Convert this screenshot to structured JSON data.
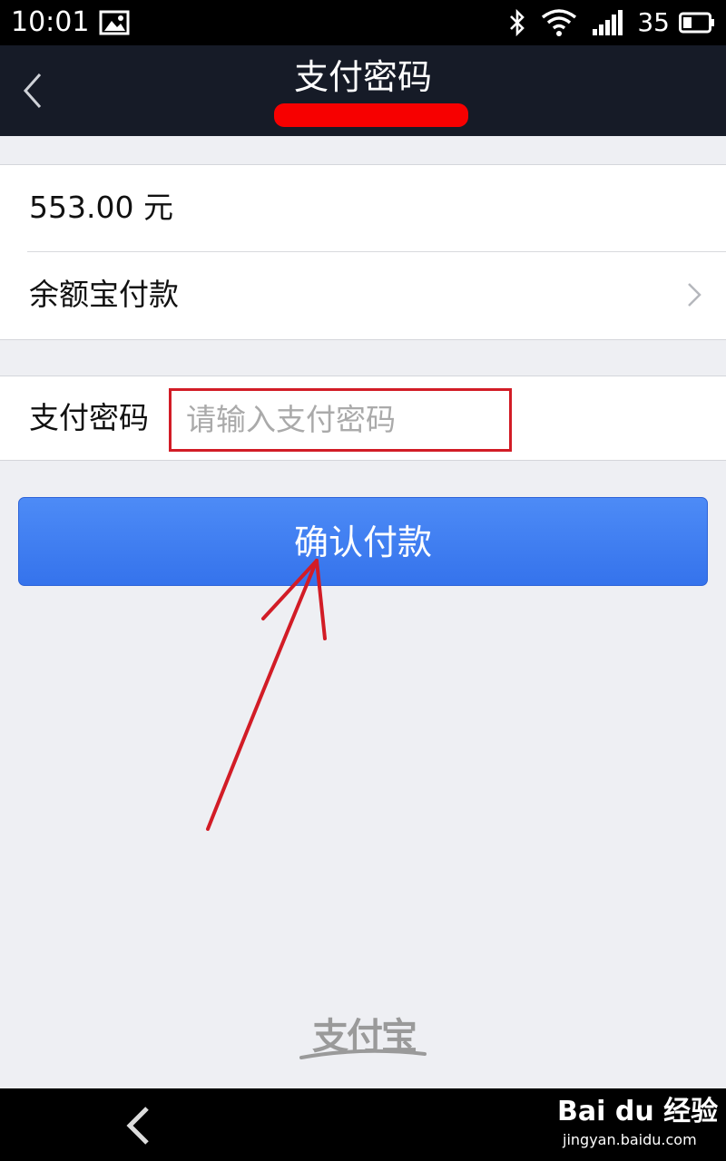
{
  "status_bar": {
    "time": "10:01",
    "battery": "35"
  },
  "header": {
    "title": "支付密码"
  },
  "order": {
    "amount": "553.00 元",
    "payment_method": "余额宝付款"
  },
  "password": {
    "label": "支付密码",
    "placeholder": "请输入支付密码"
  },
  "confirm": {
    "label": "确认付款"
  },
  "footer": {
    "logo_text": "支付宝"
  },
  "watermark": {
    "brand": "Bai du 经验",
    "url": "jingyan.baidu.com"
  },
  "colors": {
    "title_bar": "#161b27",
    "button": "#3c7cf0",
    "annotation_red": "#d21c26",
    "background": "#eeeff3"
  }
}
